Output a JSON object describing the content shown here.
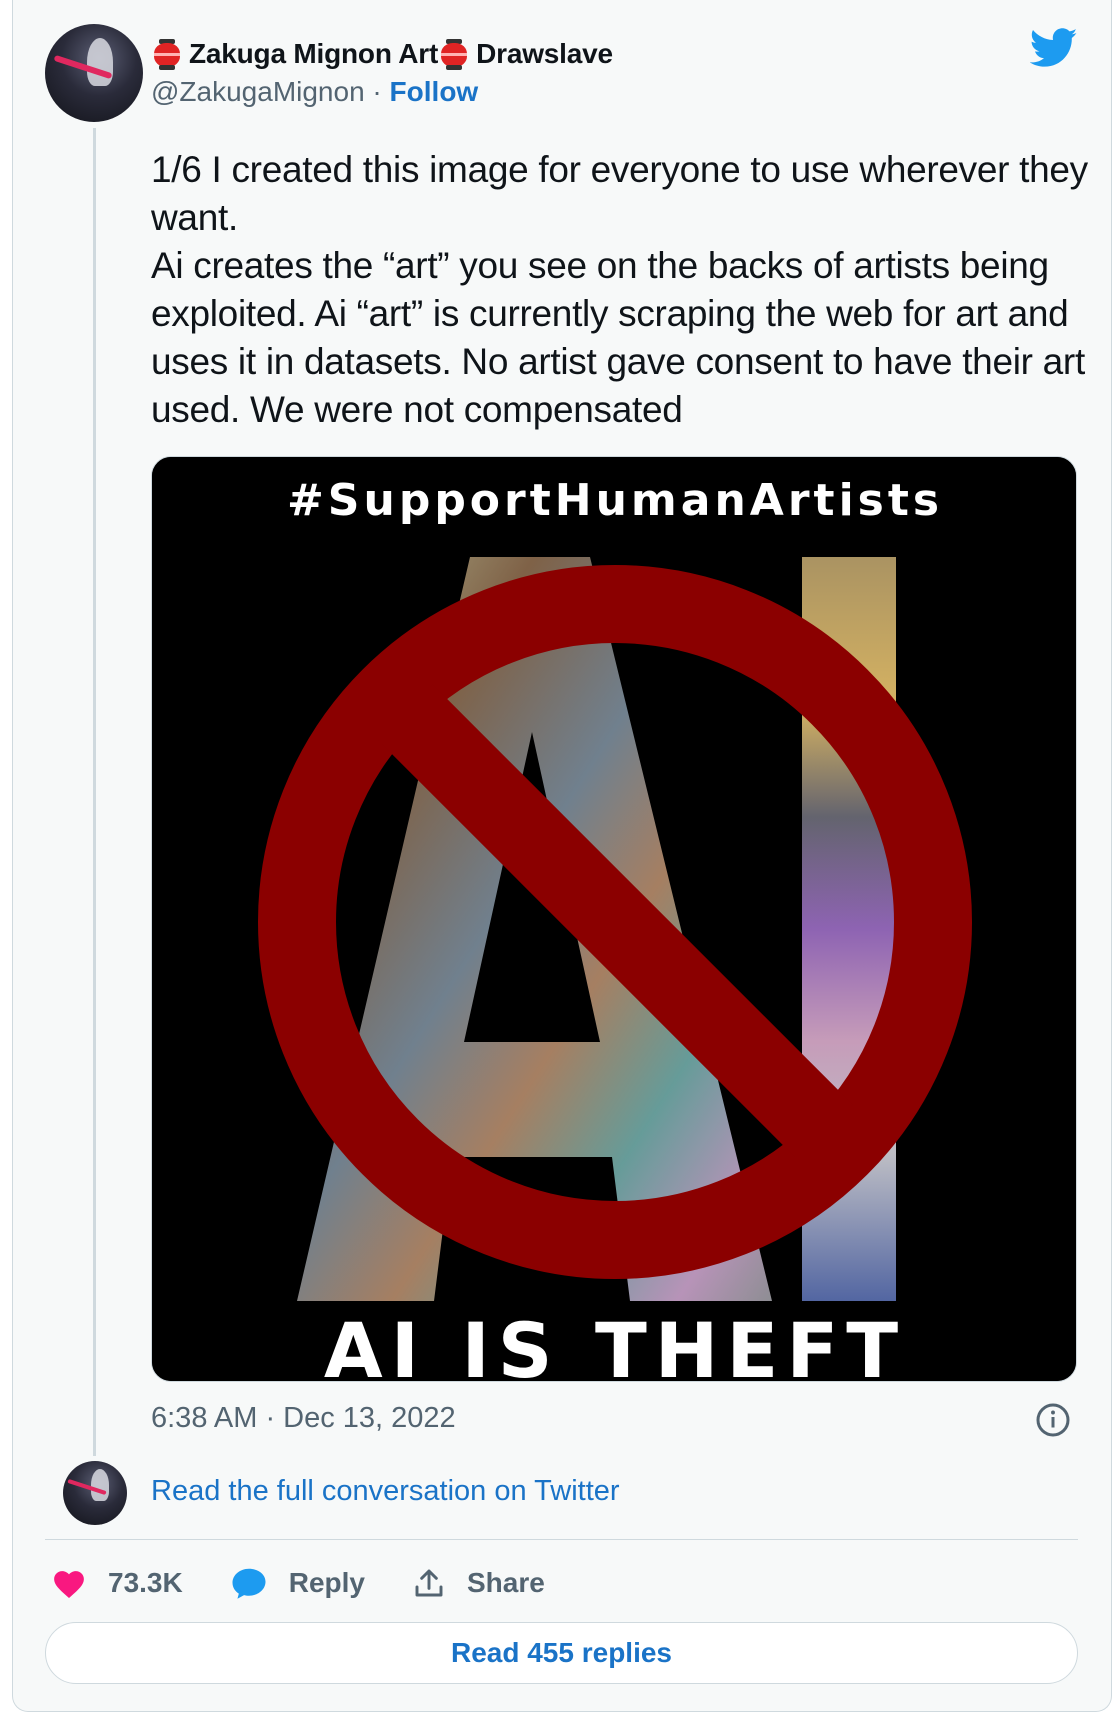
{
  "author": {
    "display_name_part1": "Zakuga Mignon Art",
    "display_name_part2": "Drawslave",
    "handle": "@ZakugaMignon",
    "separator": " · ",
    "follow_label": "Follow"
  },
  "tweet": {
    "paragraph1": "1/6 I created this image for everyone to use wherever they want.",
    "paragraph2": "Ai creates the “art” you see on the backs of artists being exploited. Ai “art” is currently scraping the web for art and uses it in datasets. No artist gave consent to have their art used. We were not compensated",
    "timestamp": "6:38 AM · Dec 13, 2022"
  },
  "media": {
    "hashtag": "#SupportHumanArtists",
    "big_letters": "AI",
    "bottom_text": "AI IS THEFT",
    "prohibition_color": "#8b0000"
  },
  "conversation_link": "Read the full conversation on Twitter",
  "actions": {
    "likes": "73.3K",
    "reply": "Reply",
    "share": "Share"
  },
  "read_replies": "Read 455 replies",
  "icons": {
    "brand": "twitter-bird-icon",
    "info": "info-icon",
    "like": "heart-icon",
    "reply": "speech-bubble-icon",
    "share": "share-upload-icon"
  },
  "colors": {
    "link_blue": "#1a73c7",
    "twitter_blue": "#1d9bf0",
    "heart_pink": "#f91880",
    "muted": "#536471"
  }
}
